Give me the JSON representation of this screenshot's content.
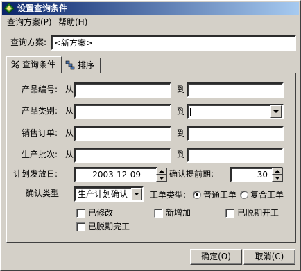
{
  "window": {
    "title": "设置查询条件",
    "icon": "app-icon"
  },
  "menu": [
    {
      "label": "查询方案(P)"
    },
    {
      "label": "帮助(H)"
    }
  ],
  "scheme": {
    "label": "查询方案:",
    "value": "<新方案>"
  },
  "tabs": [
    {
      "label": "查询条件",
      "icon": "filter-icon",
      "active": true
    },
    {
      "label": "排序",
      "icon": "sort-icon",
      "active": false
    }
  ],
  "rows": [
    {
      "label": "产品编号:",
      "from": "从",
      "to": "到",
      "from_value": "",
      "to_value": ""
    },
    {
      "label": "产品类别:",
      "from": "从",
      "to": "到",
      "from_value": "",
      "to_value": ""
    },
    {
      "label": "销售订单:",
      "from": "从",
      "to": "到",
      "from_value": "",
      "to_value": ""
    },
    {
      "label": "生产批次:",
      "from": "从",
      "to": "到",
      "from_value": "",
      "to_value": ""
    }
  ],
  "plan_date": {
    "label": "计划发放日:",
    "value": "2003-12-09"
  },
  "advance": {
    "label": "确认提前期:",
    "value": "30"
  },
  "confirm_type": {
    "label": "确认类型",
    "value": "生产计划确认"
  },
  "order_type": {
    "label": "工单类型:",
    "options": [
      "普通工单",
      "复合工单"
    ],
    "selected": "普通工单"
  },
  "checkboxes": [
    {
      "label": "已修改",
      "checked": false
    },
    {
      "label": "新增加",
      "checked": false
    },
    {
      "label": "已脱期开工",
      "checked": false
    },
    {
      "label": "已脱期完工",
      "checked": false
    }
  ],
  "buttons": {
    "ok": "确定(O)",
    "cancel": "取消(C)"
  }
}
